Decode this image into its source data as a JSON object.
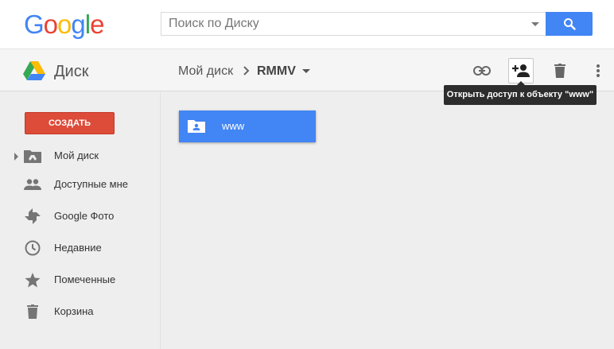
{
  "header": {
    "logo_letters": [
      {
        "ch": "G",
        "color": "#4285f4"
      },
      {
        "ch": "o",
        "color": "#ea4335"
      },
      {
        "ch": "o",
        "color": "#fbbc05"
      },
      {
        "ch": "g",
        "color": "#4285f4"
      },
      {
        "ch": "l",
        "color": "#34a853"
      },
      {
        "ch": "e",
        "color": "#ea4335"
      }
    ],
    "search_placeholder": "Поиск по Диску",
    "search_button_icon": "search-icon"
  },
  "toolbar": {
    "app_title": "Диск",
    "breadcrumb_root": "Мой диск",
    "breadcrumb_current": "RMMV",
    "icons": [
      "link-icon",
      "add-person-icon",
      "trash-icon",
      "more-vert-icon"
    ],
    "tooltip": "Открыть доступ к объекту \"www\""
  },
  "sidebar": {
    "create_label": "СОЗДАТЬ",
    "items": [
      {
        "label": "Мой диск",
        "icon": "my-drive-icon"
      },
      {
        "label": "Доступные мне",
        "icon": "shared-people-icon"
      },
      {
        "label": "Google Фото",
        "icon": "photos-pinwheel-icon"
      },
      {
        "label": "Недавние",
        "icon": "clock-icon"
      },
      {
        "label": "Помеченные",
        "icon": "star-icon"
      },
      {
        "label": "Корзина",
        "icon": "trash-icon"
      }
    ]
  },
  "main": {
    "folders": [
      {
        "name": "www",
        "icon": "shared-folder-icon"
      }
    ]
  },
  "colors": {
    "accent_blue": "#4285f4",
    "create_red": "#dd4b39",
    "tooltip_bg": "#2d2d2d"
  }
}
